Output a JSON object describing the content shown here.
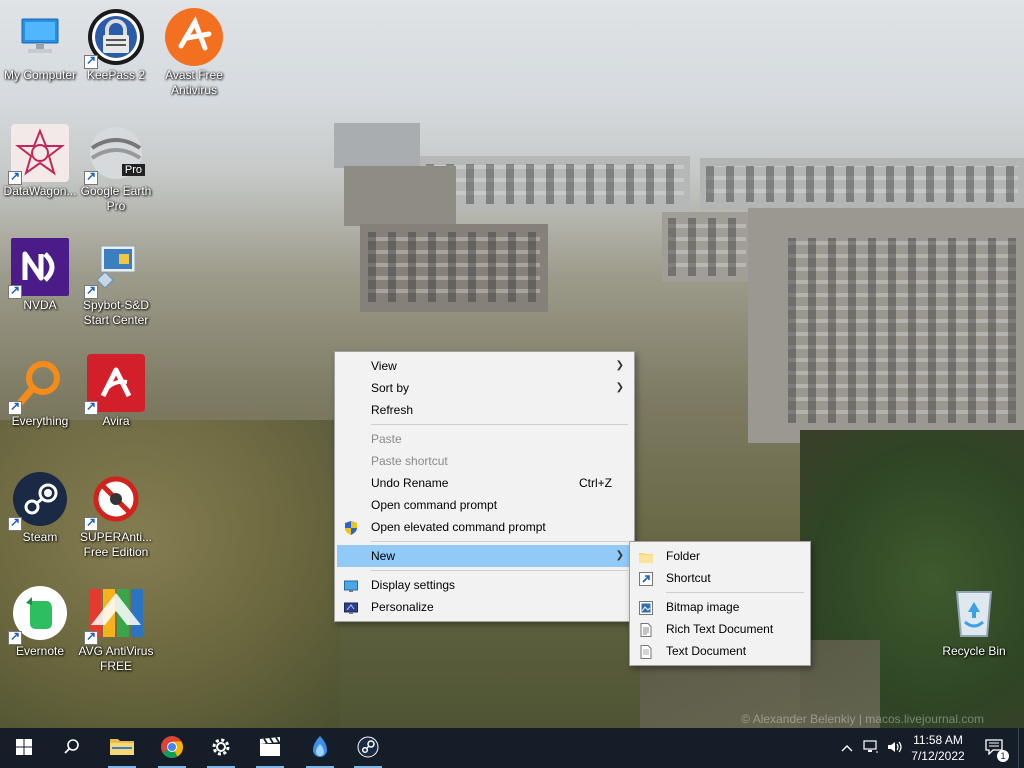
{
  "desktop": {
    "icons": [
      {
        "label": "My Computer",
        "icon": "computer-icon"
      },
      {
        "label": "KeePass 2",
        "icon": "keepass-icon"
      },
      {
        "label": "Avast Free\nAntivirus",
        "icon": "avast-icon"
      },
      {
        "label": "DataWagon...",
        "icon": "datawagon-icon"
      },
      {
        "label": "Google Earth\nPro",
        "icon": "google-earth-icon",
        "badge": "Pro"
      },
      {
        "label": "NVDA",
        "icon": "nvda-icon"
      },
      {
        "label": "Spybot-S&D\nStart Center",
        "icon": "spybot-icon"
      },
      {
        "label": "Everything",
        "icon": "everything-icon"
      },
      {
        "label": "Avira",
        "icon": "avira-icon"
      },
      {
        "label": "Steam",
        "icon": "steam-icon"
      },
      {
        "label": "SUPERAnti...\nFree Edition",
        "icon": "superantispyware-icon"
      },
      {
        "label": "Evernote",
        "icon": "evernote-icon"
      },
      {
        "label": "AVG AntiVirus\nFREE",
        "icon": "avg-icon"
      },
      {
        "label": "Recycle Bin",
        "icon": "recycle-bin-icon"
      }
    ],
    "wallpaper_credit": "© Alexander Belenkiy | macos.livejournal.com"
  },
  "context_menu": {
    "items": [
      {
        "label": "View",
        "submenu": true
      },
      {
        "label": "Sort by",
        "submenu": true
      },
      {
        "label": "Refresh"
      },
      {
        "label": "Paste",
        "disabled": true
      },
      {
        "label": "Paste shortcut",
        "disabled": true
      },
      {
        "label": "Undo Rename",
        "shortcut": "Ctrl+Z"
      },
      {
        "label": "Open command prompt"
      },
      {
        "label": "Open elevated command prompt",
        "icon": "uac-shield-icon"
      },
      {
        "label": "New",
        "submenu": true,
        "highlighted": true
      },
      {
        "label": "Display settings",
        "icon": "display-settings-icon"
      },
      {
        "label": "Personalize",
        "icon": "personalize-icon"
      }
    ]
  },
  "new_submenu": {
    "items": [
      {
        "label": "Folder",
        "icon": "folder-icon"
      },
      {
        "label": "Shortcut",
        "icon": "shortcut-icon"
      },
      {
        "label": "Bitmap image",
        "icon": "bitmap-icon"
      },
      {
        "label": "Rich Text Document",
        "icon": "rtf-icon"
      },
      {
        "label": "Text Document",
        "icon": "text-document-icon"
      }
    ]
  },
  "taskbar": {
    "pinned": [
      {
        "name": "start-button",
        "icon": "windows-logo-icon"
      },
      {
        "name": "search-button",
        "icon": "search-icon"
      },
      {
        "name": "file-explorer",
        "icon": "folder-icon"
      },
      {
        "name": "chrome",
        "icon": "chrome-icon"
      },
      {
        "name": "settings",
        "icon": "gear-icon"
      },
      {
        "name": "video-editor",
        "icon": "clapperboard-icon"
      },
      {
        "name": "app-blue-flame",
        "icon": "flame-icon"
      },
      {
        "name": "steam",
        "icon": "steam-icon"
      }
    ],
    "clock": {
      "time": "11:58 AM",
      "date": "7/12/2022"
    },
    "notification_count": "1"
  },
  "colors": {
    "taskbar": "#141d28",
    "menu_bg": "#f2f2f2",
    "menu_highlight": "#91c9f7",
    "active_indicator": "#7fb7e8"
  }
}
